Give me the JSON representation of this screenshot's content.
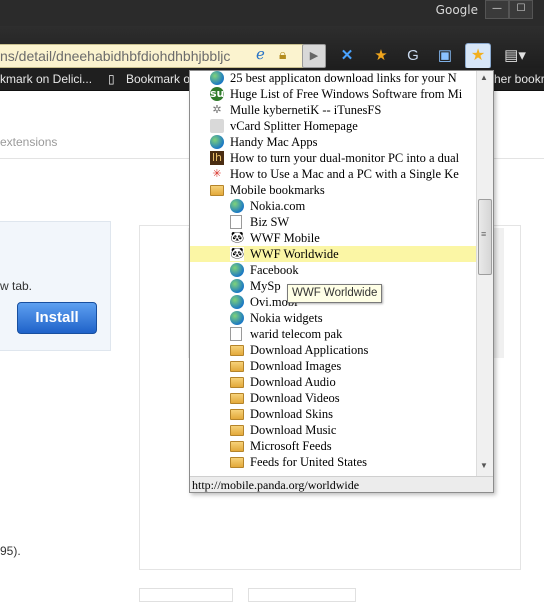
{
  "window": {
    "brand_text": "Google",
    "minimize_symbol": "—",
    "maximize_symbol": "☐"
  },
  "toolbar": {
    "url_text": "ns/detail/dneehabidhbfdiohdhbhjbbljc",
    "go_symbol": "▶",
    "icons": [
      "ie-icon",
      "lock-icon",
      "go-arrow-icon",
      "extension-cross-icon",
      "extension-star-icon",
      "extension-g-icon",
      "extension-picture-icon",
      "bookmark-star-icon",
      "page-menu-icon"
    ]
  },
  "bookmarks_bar": {
    "items": [
      {
        "label": "kmark on Delici..."
      },
      {
        "label": "Bookmark o"
      },
      {
        "label": "her bookr"
      }
    ]
  },
  "page": {
    "subtitle": "extensions",
    "new_tab_text": "w tab.",
    "install_label": "Install",
    "footnote": "95)."
  },
  "bookmark_menu": {
    "items": [
      {
        "label": "25 best applicaton download links for your N",
        "icon": "globe"
      },
      {
        "label": "Huge List of Free Windows Software from Mi",
        "icon": "stumbleupon"
      },
      {
        "label": "Mulle kybernetiK -- iTunesFS",
        "icon": "gear"
      },
      {
        "label": "vCard Splitter Homepage",
        "icon": "apple"
      },
      {
        "label": "Handy Mac Apps",
        "icon": "globe"
      },
      {
        "label": "How to turn your dual-monitor PC into a dual",
        "icon": "dual"
      },
      {
        "label": "How to Use a Mac and a PC with a Single Ke",
        "icon": "flower"
      },
      {
        "label": "Mobile bookmarks",
        "icon": "folder"
      },
      {
        "label": "Nokia.com",
        "icon": "globe"
      },
      {
        "label": "Biz SW",
        "icon": "page"
      },
      {
        "label": "WWF Mobile",
        "icon": "panda"
      },
      {
        "label": "WWF Worldwide",
        "icon": "panda"
      },
      {
        "label": "Facebook",
        "icon": "globe"
      },
      {
        "label": "MySp",
        "icon": "globe"
      },
      {
        "label": "Ovi.mobi",
        "icon": "globe"
      },
      {
        "label": "Nokia widgets",
        "icon": "globe"
      },
      {
        "label": "warid telecom pak",
        "icon": "page"
      },
      {
        "label": "Download Applications",
        "icon": "folder"
      },
      {
        "label": "Download Images",
        "icon": "folder"
      },
      {
        "label": "Download Audio",
        "icon": "folder"
      },
      {
        "label": "Download Videos",
        "icon": "folder"
      },
      {
        "label": "Download Skins",
        "icon": "folder"
      },
      {
        "label": "Download Music",
        "icon": "folder"
      },
      {
        "label": "Microsoft Feeds",
        "icon": "folder"
      },
      {
        "label": "Feeds for United States",
        "icon": "folder"
      }
    ],
    "selected_label": "WWF Worldwide",
    "tooltip": "WWF Worldwide",
    "status_url": "http://mobile.panda.org/worldwide",
    "scroll_up_symbol": "▲",
    "scroll_down_symbol": "▼"
  }
}
